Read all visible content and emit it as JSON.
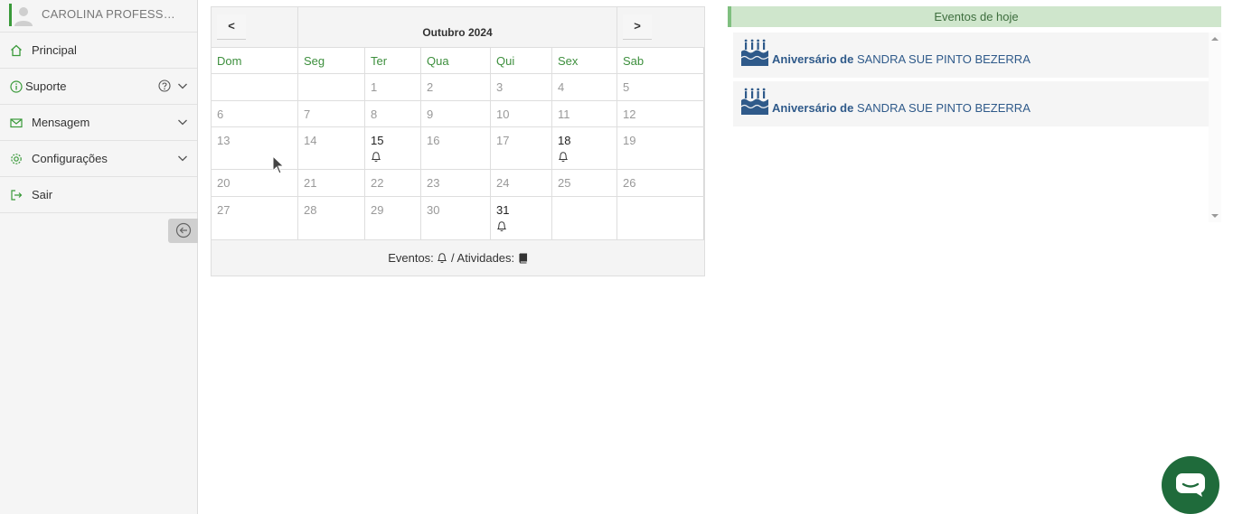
{
  "user": {
    "name": "CAROLINA PROFESSORA"
  },
  "nav": [
    {
      "label": "Principal",
      "icon": "home-icon"
    },
    {
      "label": "Suporte",
      "icon": "info-icon"
    },
    {
      "label": "Mensagem",
      "icon": "envelope-icon"
    },
    {
      "label": "Configurações",
      "icon": "gear-icon"
    },
    {
      "label": "Sair",
      "icon": "logout-icon"
    }
  ],
  "calendar": {
    "title": "Outubro 2024",
    "prev_label": "<",
    "next_label": ">",
    "weekdays": [
      "Dom",
      "Seg",
      "Ter",
      "Qua",
      "Qui",
      "Sex",
      "Sab"
    ],
    "weeks": [
      [
        "",
        "",
        "1",
        "2",
        "3",
        "4",
        "5"
      ],
      [
        "6",
        "7",
        "8",
        "9",
        "10",
        "11",
        "12"
      ],
      [
        "13",
        "14",
        "15",
        "16",
        "17",
        "18",
        "19"
      ],
      [
        "20",
        "21",
        "22",
        "23",
        "24",
        "25",
        "26"
      ],
      [
        "27",
        "28",
        "29",
        "30",
        "31",
        "",
        ""
      ]
    ],
    "event_days": [
      "15",
      "18",
      "31"
    ],
    "footer_events_label": "Eventos:",
    "footer_sep": "/ Atividades:"
  },
  "events_panel": {
    "title": "Eventos de hoje",
    "items": [
      {
        "prefix": "Aniversário de",
        "name": "SANDRA SUE PINTO BEZERRA",
        "icon": "birthday-cake-icon"
      },
      {
        "prefix": "Aniversário de",
        "name": "SANDRA SUE PINTO BEZERRA",
        "icon": "birthday-cake-icon"
      }
    ]
  },
  "colors": {
    "accent_green": "#3a9a3a",
    "weekday_green": "#3d8f3d",
    "event_blue": "#2f5a8a",
    "chat_green": "#1f6b3b"
  }
}
